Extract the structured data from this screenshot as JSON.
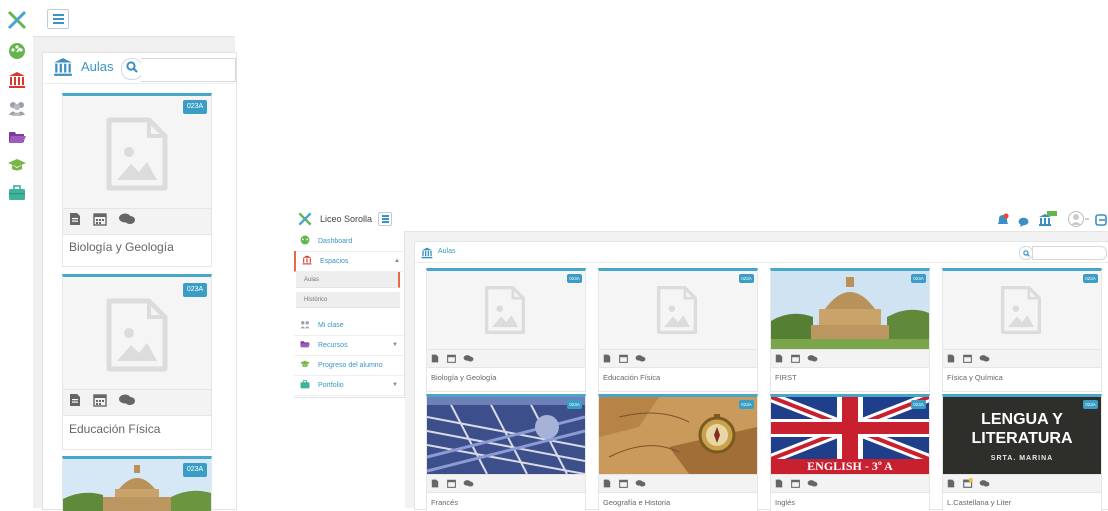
{
  "zoom": {
    "section_title": "Aulas",
    "cards": [
      {
        "badge": "023A",
        "title": "Biología y Geología"
      },
      {
        "badge": "023A",
        "title": "Educación Física"
      },
      {
        "badge": "023A",
        "title": ""
      }
    ]
  },
  "main": {
    "header": {
      "school_name": "Liceo Sorolla"
    },
    "sidebar": {
      "items": [
        {
          "label": "Dashboard",
          "icon": "dashboard-icon"
        },
        {
          "label": "Espacios",
          "icon": "institution-icon"
        },
        {
          "label": "Mi clase",
          "icon": "users-icon"
        },
        {
          "label": "Recursos",
          "icon": "folder-icon"
        },
        {
          "label": "Progreso del alumno",
          "icon": "graduation-cap-icon"
        },
        {
          "label": "Portfolio",
          "icon": "briefcase-icon"
        }
      ],
      "subitems": [
        "Aulas",
        "Histórico"
      ]
    },
    "section_title": "Aulas",
    "cards": [
      {
        "badge": "023A",
        "title": "Biología y Geología",
        "image": "placeholder"
      },
      {
        "badge": "023A",
        "title": "Educación Física",
        "image": "placeholder"
      },
      {
        "badge": "023A",
        "title": "FIRST",
        "image": "photo-oxford"
      },
      {
        "badge": "023A",
        "title": "Física y Química",
        "image": "placeholder"
      },
      {
        "badge": "023A",
        "title": "Francés",
        "image": "photo-architecture"
      },
      {
        "badge": "023A",
        "title": "Geografía e Historia",
        "image": "photo-map-compass"
      },
      {
        "badge": "023A",
        "title": "Inglés",
        "image": "photo-union-jack",
        "image_text": "ENGLISH - 3º A"
      },
      {
        "badge": "023A",
        "title": "L.Castellana y Liter",
        "image": "photo-lengua",
        "image_text_1": "LENGUA Y",
        "image_text_2": "LITERATURA",
        "image_text_3": "SRTA. MARINA"
      }
    ]
  },
  "colors": {
    "accent": "#3a9dc6",
    "card_top": "#47a6ca",
    "nav_active": "#e8694a"
  }
}
